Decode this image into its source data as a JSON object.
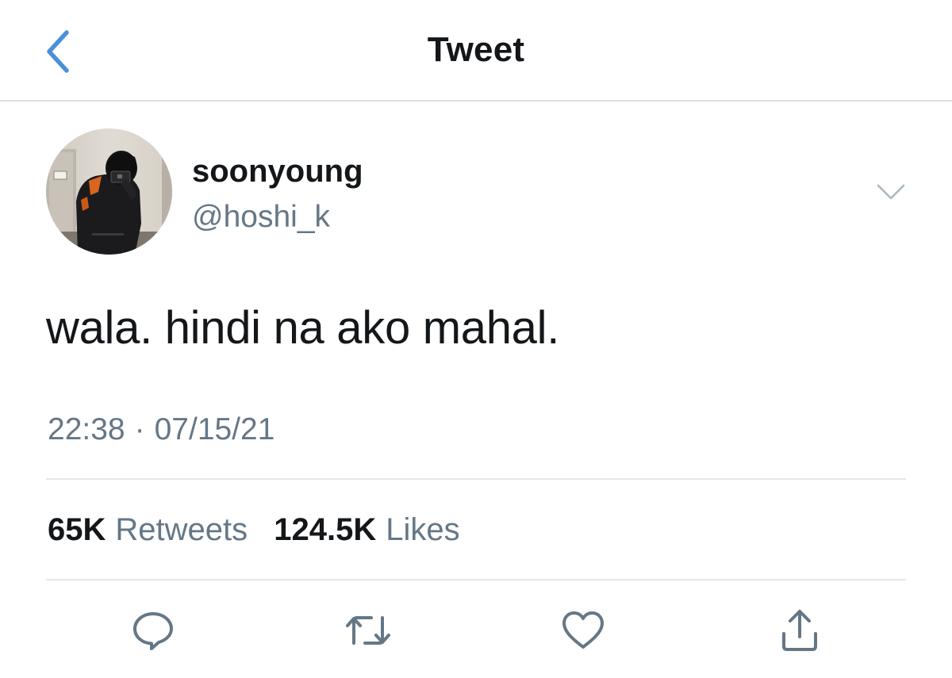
{
  "header": {
    "title": "Tweet",
    "back_icon": "chevron-left-icon",
    "accent_color": "#4a90d9"
  },
  "author": {
    "display_name": "soonyoung",
    "handle": "@hoshi_k",
    "avatar": "avatar-photo",
    "more_icon": "chevron-down-icon"
  },
  "tweet": {
    "text": "wala. hindi na ako mahal.",
    "time": "22:38",
    "separator": "·",
    "date": "07/15/21"
  },
  "stats": {
    "retweets_count": "65K",
    "retweets_label": "Retweets",
    "likes_count": "124.5K",
    "likes_label": "Likes"
  },
  "actions": {
    "reply_icon": "reply-bubble-icon",
    "retweet_icon": "retweet-icon",
    "like_icon": "heart-icon",
    "share_icon": "share-icon"
  },
  "colors": {
    "text_primary": "#14171a",
    "text_secondary": "#657786",
    "divider": "#e1e8ed"
  }
}
